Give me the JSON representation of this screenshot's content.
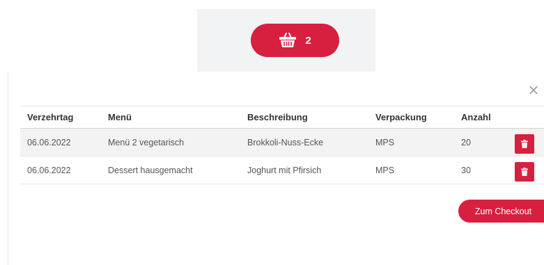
{
  "cart": {
    "count": "2",
    "icon": "basket-icon",
    "accent_color": "#d7203f"
  },
  "dialog": {
    "close_symbol": "×",
    "columns": [
      "Verzehrtag",
      "Menü",
      "Beschreibung",
      "Verpackung",
      "Anzahl"
    ],
    "rows": [
      {
        "date": "06.06.2022",
        "menu": "Menü 2 vegetarisch",
        "description": "Brokkoli-Nuss-Ecke",
        "packaging": "MPS",
        "quantity": "20"
      },
      {
        "date": "06.06.2022",
        "menu": "Dessert hausgemacht",
        "description": "Joghurt mit Pfirsich",
        "packaging": "MPS",
        "quantity": "30"
      }
    ],
    "checkout_label": "Zum Checkout"
  }
}
